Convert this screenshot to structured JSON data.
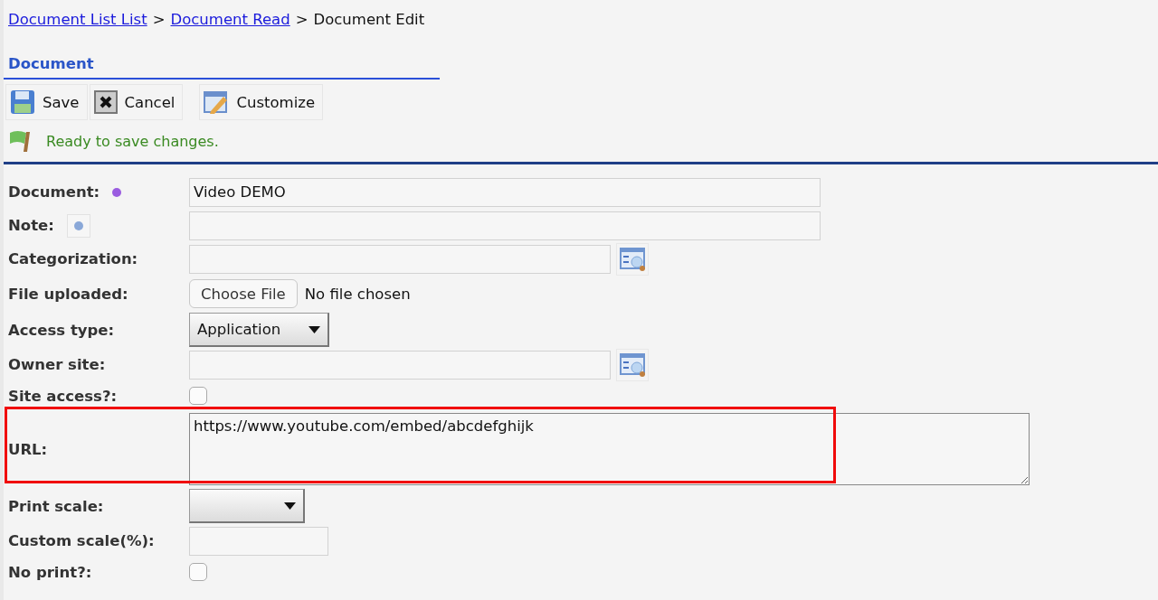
{
  "breadcrumb": {
    "links": [
      "Document List List",
      "Document Read"
    ],
    "current": "Document Edit",
    "separator": ">"
  },
  "section_title": "Document",
  "toolbar": [
    {
      "label": "Save",
      "kind": "save"
    },
    {
      "label": "Cancel",
      "kind": "cancel"
    },
    {
      "label": "Customize",
      "kind": "customize"
    }
  ],
  "status_message": "Ready to save changes.",
  "fields": [
    {
      "label": "Document:",
      "kind": "text",
      "marker": {
        "kind": "required"
      },
      "value": "Video DEMO"
    },
    {
      "label": "Note:",
      "kind": "text",
      "marker": {
        "kind": "help"
      }
    },
    {
      "label": "Categorization:",
      "kind": "lookup"
    },
    {
      "label": "File uploaded:",
      "kind": "file",
      "button": "Choose File",
      "status": "No file chosen"
    },
    {
      "label": "Access type:",
      "kind": "select",
      "value": "Application"
    },
    {
      "label": "Owner site:",
      "kind": "lookup"
    },
    {
      "label": "Site access?:",
      "kind": "checkbox",
      "checked": false
    },
    {
      "label": "URL:",
      "kind": "textarea",
      "value": "https://www.youtube.com/embed/abcdefghijk",
      "highlighted": true
    },
    {
      "label": "Print scale:",
      "kind": "select"
    },
    {
      "label": "Custom scale(%):",
      "kind": "short"
    },
    {
      "label": "No print?:",
      "kind": "checkbox",
      "checked": false
    }
  ]
}
